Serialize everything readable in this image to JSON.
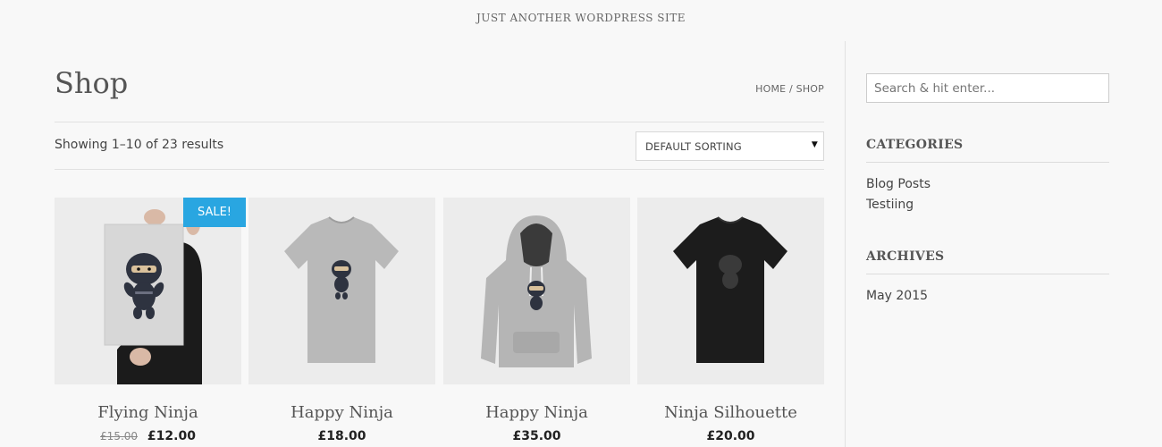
{
  "site": {
    "tagline": "JUST ANOTHER WORDPRESS SITE"
  },
  "page": {
    "title": "Shop",
    "breadcrumb": {
      "home": "HOME",
      "separator": "/",
      "current": "SHOP"
    }
  },
  "shop": {
    "result_count": "Showing 1–10 of 23 results",
    "sorting": {
      "selected": "DEFAULT SORTING"
    },
    "products": [
      {
        "title": "Flying Ninja",
        "old_price": "£15.00",
        "price": "£12.00",
        "badge": "SALE!",
        "image": "poster-ninja"
      },
      {
        "title": "Happy Ninja",
        "price": "£18.00",
        "image": "grey-tshirt-ninja"
      },
      {
        "title": "Happy Ninja",
        "price": "£35.00",
        "image": "grey-hoodie-ninja"
      },
      {
        "title": "Ninja Silhouette",
        "price": "£20.00",
        "image": "black-tshirt-silhouette"
      }
    ]
  },
  "sidebar": {
    "search": {
      "placeholder": "Search & hit enter..."
    },
    "categories": {
      "title": "CATEGORIES",
      "items": [
        "Blog Posts",
        "Testiing"
      ]
    },
    "archives": {
      "title": "ARCHIVES",
      "items": [
        "May 2015"
      ]
    }
  },
  "colors": {
    "background": "#f8f8f8",
    "sale_badge": "#29a6e1",
    "thumb_bg": "#ebebeb"
  }
}
